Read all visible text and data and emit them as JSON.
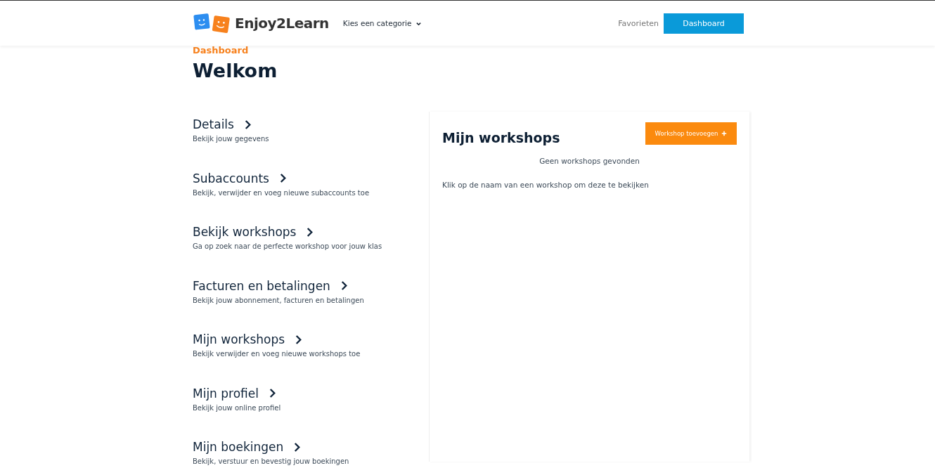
{
  "header": {
    "brand": "Enjoy2Learn",
    "category_menu": "Kies een categorie",
    "links": [
      {
        "label": "Favorieten",
        "kind": "link"
      },
      {
        "label": "Dashboard",
        "kind": "button"
      }
    ]
  },
  "breadcrumb": "Dashboard",
  "title": "Welkom",
  "menu": [
    {
      "title": "Details",
      "description": "Bekijk jouw gegevens"
    },
    {
      "title": "Subaccounts",
      "description": "Bekijk, verwijder en voeg nieuwe subaccounts toe"
    },
    {
      "title": "Bekijk workshops",
      "description": "Ga op zoek naar de perfecte workshop voor jouw klas"
    },
    {
      "title": "Facturen en betalingen",
      "description": "Bekijk jouw abonnement, facturen en betalingen"
    },
    {
      "title": "Mijn workshops",
      "description": "Bekijk verwijder en voeg nieuwe workshops toe"
    },
    {
      "title": "Mijn profiel",
      "description": "Bekijk jouw online profiel"
    },
    {
      "title": "Mijn boekingen",
      "description": "Bekijk, verstuur en bevestig jouw boekingen"
    }
  ],
  "panel": {
    "title": "Mijn workshops",
    "add_button": "Workshop toevoegen",
    "empty_message": "Geen workshops gevonden",
    "hint": "Klik op de naam van een workshop om deze te bekijken"
  }
}
